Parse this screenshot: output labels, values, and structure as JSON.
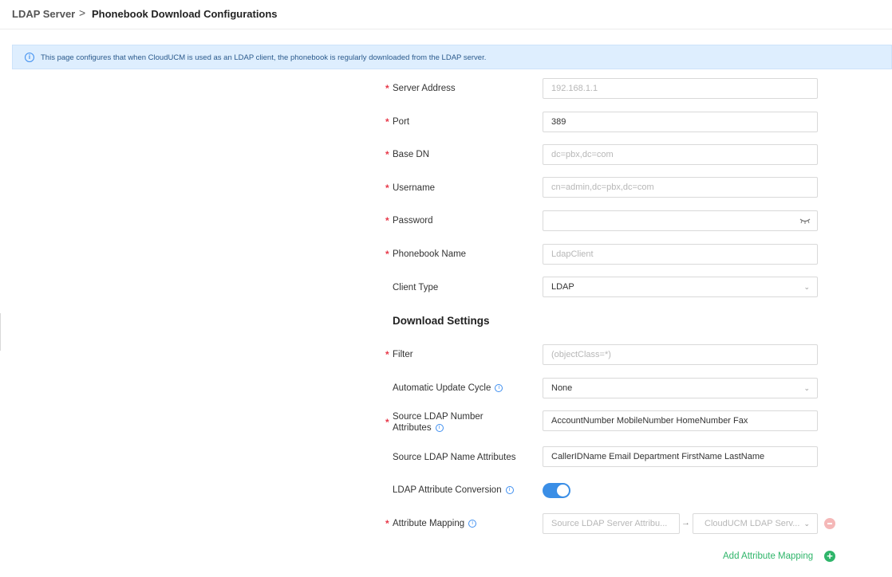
{
  "breadcrumb": {
    "parent": "LDAP Server",
    "separator": ">",
    "current": "Phonebook Download Configurations"
  },
  "info": {
    "text": "This page configures that when CloudUCM is used as an LDAP client, the phonebook is regularly downloaded from the LDAP server.",
    "icon": "info-icon"
  },
  "form": {
    "server_address": {
      "label": "Server Address",
      "placeholder": "192.168.1.1",
      "required": true
    },
    "port": {
      "label": "Port",
      "value": "389",
      "required": true
    },
    "base_dn": {
      "label": "Base DN",
      "placeholder": "dc=pbx,dc=com",
      "required": true
    },
    "username": {
      "label": "Username",
      "placeholder": "cn=admin,dc=pbx,dc=com",
      "required": true
    },
    "password": {
      "label": "Password",
      "value": "",
      "required": true,
      "icon": "eye-closed-icon"
    },
    "phonebook_name": {
      "label": "Phonebook Name",
      "placeholder": "LdapClient",
      "required": true
    },
    "client_type": {
      "label": "Client Type",
      "value": "LDAP"
    }
  },
  "download_settings": {
    "title": "Download Settings",
    "filter": {
      "label": "Filter",
      "placeholder": "(objectClass=*)",
      "required": true
    },
    "update_cycle": {
      "label": "Automatic Update Cycle",
      "value": "None"
    },
    "number_attributes": {
      "label_line1": "Source LDAP Number",
      "label_line2": "Attributes",
      "value": "AccountNumber MobileNumber HomeNumber Fax",
      "required": true
    },
    "name_attributes": {
      "label": "Source LDAP Name Attributes",
      "value": "CallerIDName Email Department FirstName LastName"
    },
    "attribute_conversion": {
      "label": "LDAP Attribute Conversion",
      "enabled": true
    },
    "attribute_mapping": {
      "label": "Attribute Mapping",
      "required": true,
      "source_placeholder": "Source LDAP Server Attribu...",
      "arrow": "→",
      "target_placeholder": "CloudUCM LDAP Serv..."
    },
    "add_mapping_label": "Add Attribute Mapping"
  },
  "colors": {
    "accent": "#3a8ee6",
    "required": "#e8394a",
    "add": "#2fb56a",
    "info_bg": "#deeefe"
  }
}
